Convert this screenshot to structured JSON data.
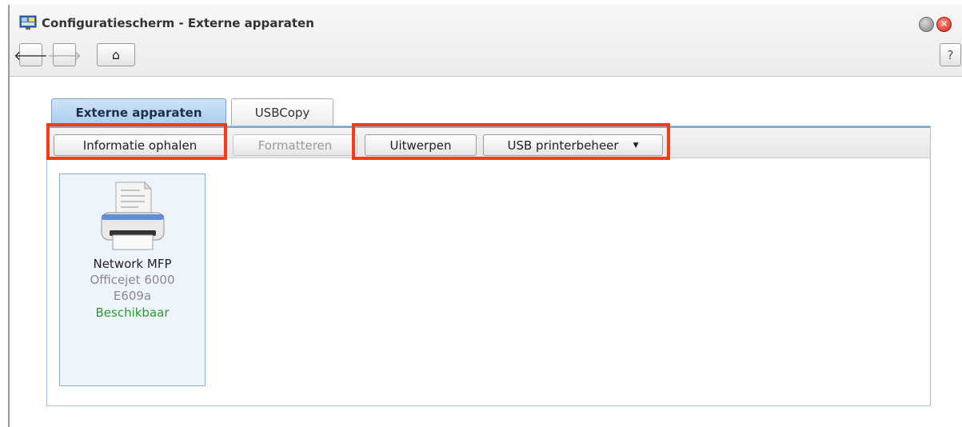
{
  "window": {
    "title": "Configuratiescherm - Externe apparaten",
    "close_glyph": "✕"
  },
  "nav": {
    "back_glyph": "🡐",
    "forward_glyph": "🡒",
    "home_glyph": "⌂",
    "help_label": "?"
  },
  "tabs": [
    {
      "label": "Externe apparaten",
      "active": true
    },
    {
      "label": "USBCopy",
      "active": false
    }
  ],
  "toolbar": {
    "info_label": "Informatie ophalen",
    "format_label": "Formatteren",
    "eject_label": "Uitwerpen",
    "usb_printer_label": "USB printerbeheer",
    "usb_printer_caret": "▼"
  },
  "devices": [
    {
      "name": "Network MFP",
      "model": "Officejet 6000",
      "id": "E609a",
      "status": "Beschikbaar"
    }
  ],
  "colors": {
    "highlight": "#ff3a12",
    "status_available": "#2a9a2a",
    "active_tab": "#a9cbee"
  },
  "icons": {
    "app": "control-panel-icon",
    "device": "printer-icon"
  }
}
